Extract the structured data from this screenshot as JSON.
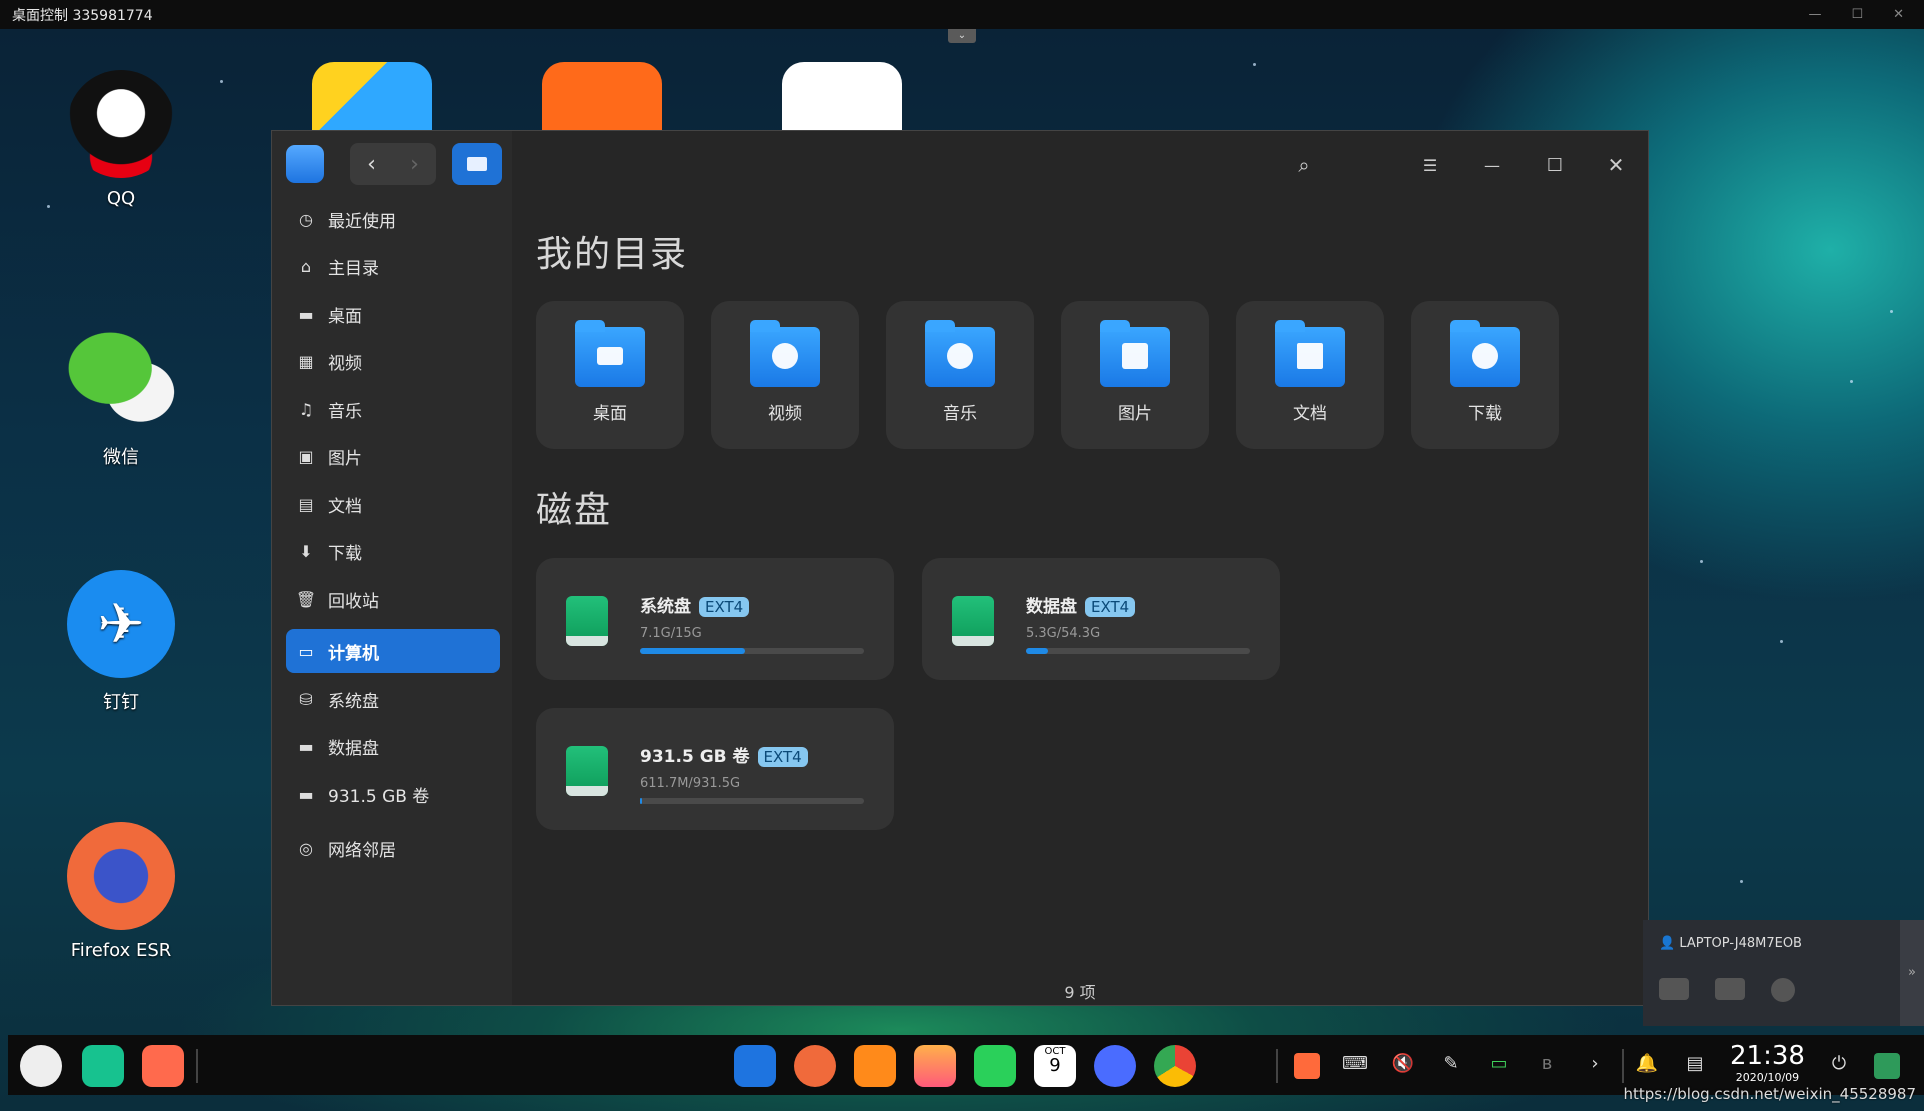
{
  "remote": {
    "title": "桌面控制 335981774",
    "ctrl_min": "—",
    "ctrl_max": "☐",
    "ctrl_close": "✕",
    "drop": "⌄"
  },
  "desktop": [
    {
      "label": "QQ",
      "color": "#ffd400"
    },
    {
      "label": "微信",
      "color": "#2dc100"
    },
    {
      "label": "钉钉",
      "color": "#1a8cf0"
    },
    {
      "label": "Firefox ESR",
      "color": "#f06a3b"
    }
  ],
  "window": {
    "back": "‹",
    "forward": "›",
    "search_icon": "⌕",
    "menu_icon": "☰",
    "min_icon": "—",
    "max_icon": "☐",
    "close_icon": "✕",
    "sidebar": [
      {
        "label": "最近使用",
        "icon": "◷"
      },
      {
        "label": "主目录",
        "icon": "⌂"
      },
      {
        "label": "桌面",
        "icon": "▬"
      },
      {
        "label": "视频",
        "icon": "▦"
      },
      {
        "label": "音乐",
        "icon": "♫"
      },
      {
        "label": "图片",
        "icon": "▣"
      },
      {
        "label": "文档",
        "icon": "▤"
      },
      {
        "label": "下载",
        "icon": "⬇"
      },
      {
        "label": "回收站",
        "icon": "🗑"
      },
      {
        "label": "计算机",
        "icon": "▭"
      },
      {
        "label": "系统盘",
        "icon": "⛁"
      },
      {
        "label": "数据盘",
        "icon": "▬"
      },
      {
        "label": "931.5 GB 卷",
        "icon": "▬"
      },
      {
        "label": "网络邻居",
        "icon": "◎"
      }
    ],
    "my_dirs_title": "我的目录",
    "folders": [
      "桌面",
      "视频",
      "音乐",
      "图片",
      "文档",
      "下载"
    ],
    "disks_title": "磁盘",
    "disks": [
      {
        "name": "系统盘",
        "fs": "EXT4",
        "size": "7.1G/15G",
        "usage": 0.47
      },
      {
        "name": "数据盘",
        "fs": "EXT4",
        "size": "5.3G/54.3G",
        "usage": 0.1
      },
      {
        "name": "931.5 GB 卷",
        "fs": "EXT4",
        "size": "611.7M/931.5G",
        "usage": 0.01
      }
    ],
    "status": "9 项"
  },
  "remote_panel": {
    "host": "LAPTOP-J48M7EOB",
    "expand": "»"
  },
  "taskbar": {
    "time": "21:38",
    "date": "2020/10/09",
    "calendar_month": "OCT",
    "calendar_day": "9"
  },
  "watermark": "https://blog.csdn.net/weixin_45528987"
}
